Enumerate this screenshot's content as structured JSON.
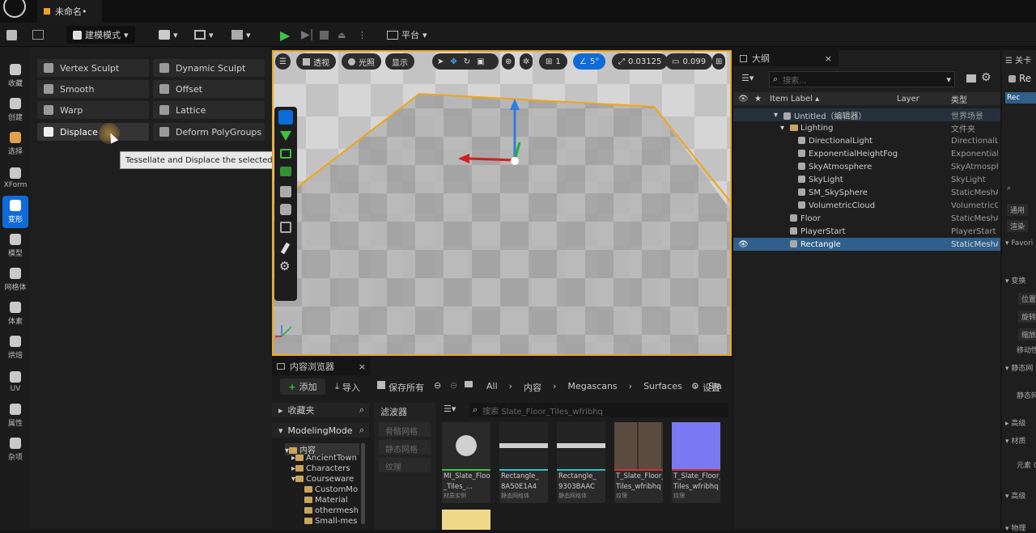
{
  "title": {
    "doc_name": "未命名•"
  },
  "toolbar": {
    "mode": "建模模式",
    "platform": "平台"
  },
  "leftbar": {
    "items": [
      "收藏",
      "创建",
      "选择",
      "XForm",
      "变形",
      "模型",
      "网格体",
      "体素",
      "烘焙",
      "UV",
      "属性",
      "杂项"
    ]
  },
  "tools": {
    "vertex_sculpt": "Vertex Sculpt",
    "dynamic_sculpt": "Dynamic Sculpt",
    "smooth": "Smooth",
    "offset": "Offset",
    "warp": "Warp",
    "lattice": "Lattice",
    "displace": "Displace",
    "deform_polygroups": "Deform PolyGroups"
  },
  "tooltip": "Tessellate and Displace the selected Mesh",
  "viewport": {
    "perspective": "透视",
    "lit": "光照",
    "show": "显示",
    "grid_size": "1",
    "angle": "5°",
    "scale": "0.03125",
    "camera_speed": "0.099"
  },
  "content_browser": {
    "tab": "内容浏览器",
    "add": "添加",
    "import": "导入",
    "save_all": "保存所有",
    "path": [
      "All",
      "内容",
      "Megascans",
      "Surfaces",
      "Sla"
    ],
    "settings": "设置",
    "favorites": "收藏夹",
    "root": "ModelingMode",
    "filters": "滤波器",
    "filter_items": [
      "骨骼网格体",
      "静态网格体",
      "纹理"
    ],
    "search_placeholder": "搜索 Slate_Floor_Tiles_wfribhq",
    "tree": [
      {
        "label": "内容"
      },
      {
        "label": "AncientTown"
      },
      {
        "label": "Characters"
      },
      {
        "label": "Courseware"
      },
      {
        "label": "CustomMo"
      },
      {
        "label": "Material"
      },
      {
        "label": "othermesh"
      },
      {
        "label": "Small-mes"
      }
    ],
    "assets": [
      {
        "name1": "MI_Slate_Floor",
        "name2": "_Tiles_...",
        "type": "材质实例"
      },
      {
        "name1": "Rectangle_",
        "name2": "8A50E1A4",
        "type": "静态网格体"
      },
      {
        "name1": "Rectangle_",
        "name2": "9303BAAC",
        "type": "静态网格体"
      },
      {
        "name1": "T_Slate_Floor_",
        "name2": "Tiles_wfribhq",
        "type": "纹理"
      },
      {
        "name1": "T_Slate_Floor_",
        "name2": "Tiles_wfribhq",
        "type": "纹理"
      }
    ]
  },
  "outliner": {
    "tab": "大纲",
    "search_placeholder": "搜索...",
    "col_label": "Item Label ▴",
    "col_layer": "Layer",
    "col_type": "类型",
    "rows": [
      {
        "label": "Untitled（编辑器）",
        "type": "世界场景"
      },
      {
        "label": "Lighting",
        "type": "文件夹"
      },
      {
        "label": "DirectionalLight",
        "type": "DirectionalLi"
      },
      {
        "label": "ExponentialHeightFog",
        "type": "Exponentiall"
      },
      {
        "label": "SkyAtmosphere",
        "type": "SkyAtmosph"
      },
      {
        "label": "SkyLight",
        "type": "SkyLight"
      },
      {
        "label": "SM_SkySphere",
        "type": "StaticMeshA"
      },
      {
        "label": "VolumetricCloud",
        "type": "VolumetricCl"
      },
      {
        "label": "Floor",
        "type": "StaticMeshA"
      },
      {
        "label": "PlayerStart",
        "type": "PlayerStart"
      },
      {
        "label": "Rectangle",
        "type": "StaticMeshA"
      }
    ]
  },
  "details": {
    "tab": "关卡",
    "re": "Re",
    "rec": "Rec",
    "general": "通用",
    "render": "渲染",
    "favorites": "Favori",
    "transform": "变换",
    "loc": "位置",
    "rot": "旋转",
    "scale": "缩放",
    "mobility": "移动性",
    "static_mesh": "静态网",
    "static_mesh2": "静态网",
    "advanced": "高级",
    "material": "材质",
    "element": "元素 0",
    "advanced2": "高级",
    "physics": "物理"
  }
}
